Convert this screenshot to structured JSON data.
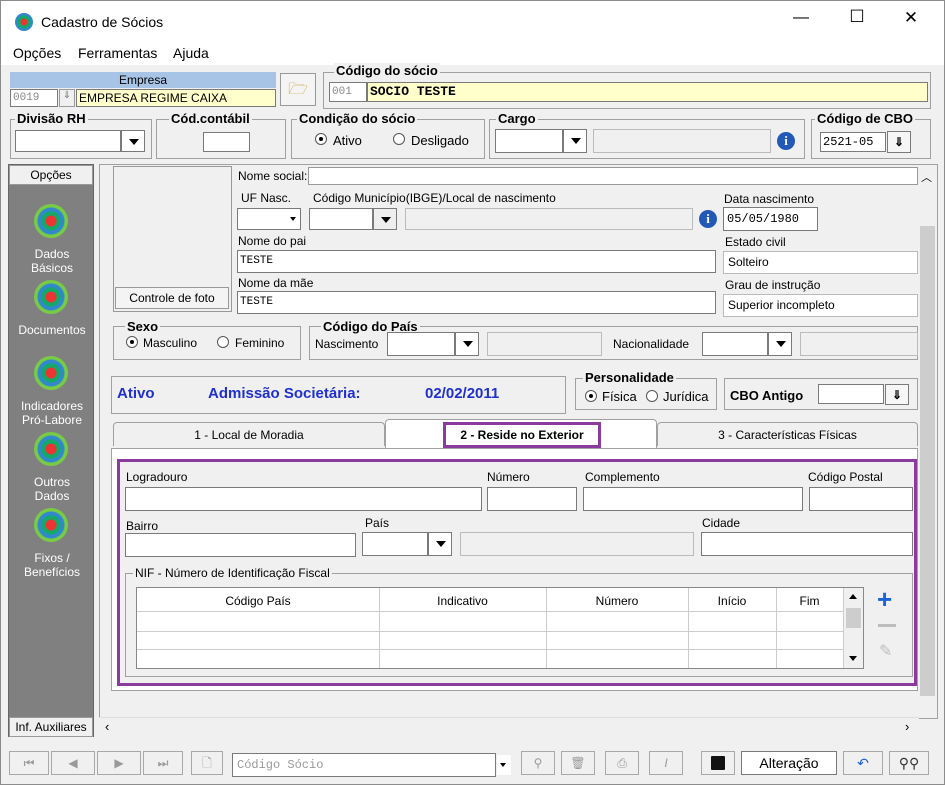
{
  "window": {
    "title": "Cadastro de Sócios",
    "minimize": "—",
    "maximize": "☐",
    "close": "✕"
  },
  "menu": [
    "Opções",
    "Ferramentas",
    "Ajuda"
  ],
  "empresa": {
    "label": "Empresa",
    "code": "0019",
    "name": "EMPRESA REGIME CAIXA"
  },
  "codigo_socio": {
    "label": "Código do sócio",
    "code": "001",
    "name": "SOCIO TESTE"
  },
  "divisao_rh": {
    "label": "Divisão RH",
    "value": ""
  },
  "cod_contabil": {
    "label": "Cód.contábil",
    "value": ""
  },
  "condicao": {
    "label": "Condição do sócio",
    "options": [
      "Ativo",
      "Desligado"
    ],
    "selected": "Ativo"
  },
  "cargo": {
    "label": "Cargo",
    "value": ""
  },
  "cbo": {
    "label": "Código de CBO",
    "value": "2521-05"
  },
  "sidebar": {
    "header": "Opções",
    "items": [
      "Dados Básicos",
      "Documentos",
      "Indicadores Pró-Labore",
      "Outros Dados",
      "Fixos / Benefícios"
    ],
    "footer": "Inf. Auxiliares"
  },
  "photo": {
    "button": "Controle de foto"
  },
  "form": {
    "nome_social_label": "Nome social:",
    "nome_social": "",
    "uf_nasc_label": "UF Nasc.",
    "uf_nasc": "",
    "municipio_label": "Código Município(IBGE)/Local de nascimento",
    "data_nasc_label": "Data nascimento",
    "data_nasc": "05/05/1980",
    "pai_label": "Nome do pai",
    "pai": "TESTE",
    "estado_civil_label": "Estado civil",
    "estado_civil": "Solteiro",
    "mae_label": "Nome da mãe",
    "mae": "TESTE",
    "grau_label": "Grau de instrução",
    "grau": "Superior incompleto"
  },
  "sexo": {
    "label": "Sexo",
    "options": [
      "Masculino",
      "Feminino"
    ],
    "selected": "Masculino"
  },
  "pais": {
    "label": "Código do País",
    "nascimento": "Nascimento",
    "nacionalidade": "Nacionalidade"
  },
  "status": {
    "ativo": "Ativo",
    "admissao_label": "Admissão Societária:",
    "admissao": "02/02/2011"
  },
  "personalidade": {
    "label": "Personalidade",
    "options": [
      "Física",
      "Jurídica"
    ],
    "selected": "Física"
  },
  "cbo_antigo": {
    "label": "CBO Antigo",
    "value": ""
  },
  "tabs": [
    "1 - Local de Moradia",
    "2 - Reside no Exterior",
    "3 - Características Físicas"
  ],
  "active_tab": 1,
  "exterior": {
    "logradouro": "Logradouro",
    "numero": "Número",
    "complemento": "Complemento",
    "cep": "Código Postal",
    "bairro": "Bairro",
    "pais": "País",
    "cidade": "Cidade"
  },
  "nif": {
    "label": "NIF - Número de Identificação Fiscal",
    "columns": [
      "Código País",
      "Indicativo",
      "Número",
      "Início",
      "Fim"
    ]
  },
  "toolbar": {
    "search_placeholder": "Código Sócio",
    "status": "Alteração"
  },
  "colors": {
    "sidebar": "#808080",
    "accent_purple": "#8b3a9e",
    "blue_text": "#1f2fd0",
    "yellow_field": "#ffffcc",
    "plus_blue": "#1b63d6"
  }
}
